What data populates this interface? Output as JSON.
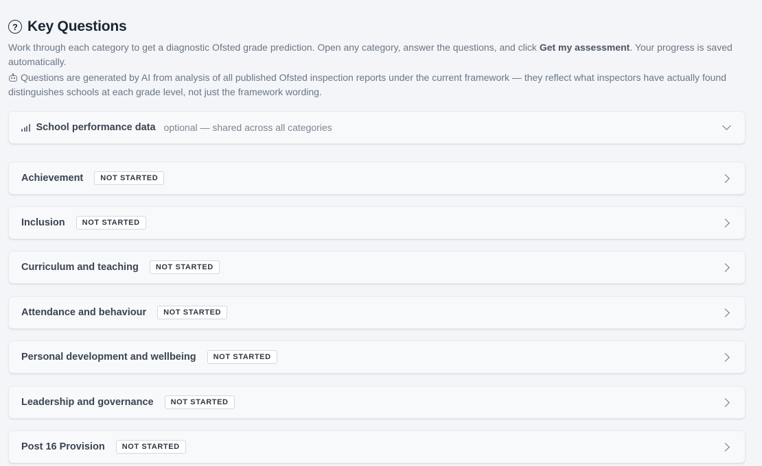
{
  "header": {
    "title": "Key Questions",
    "intro_before": "Work through each category to get a diagnostic Ofsted grade prediction. Open any category, answer the questions, and click ",
    "intro_bold": "Get my assessment",
    "intro_after": ". Your progress is saved automatically.",
    "ai_note": "Questions are generated by AI from analysis of all published Ofsted inspection reports under the current framework — they reflect what inspectors have actually found distinguishes schools at each grade level, not just the framework wording."
  },
  "performance": {
    "label": "School performance data",
    "sublabel": "optional — shared across all categories"
  },
  "categories": [
    {
      "label": "Achievement",
      "status": "NOT STARTED"
    },
    {
      "label": "Inclusion",
      "status": "NOT STARTED"
    },
    {
      "label": "Curriculum and teaching",
      "status": "NOT STARTED"
    },
    {
      "label": "Attendance and behaviour",
      "status": "NOT STARTED"
    },
    {
      "label": "Personal development and wellbeing",
      "status": "NOT STARTED"
    },
    {
      "label": "Leadership and governance",
      "status": "NOT STARTED"
    },
    {
      "label": "Post 16 Provision",
      "status": "NOT STARTED"
    }
  ]
}
